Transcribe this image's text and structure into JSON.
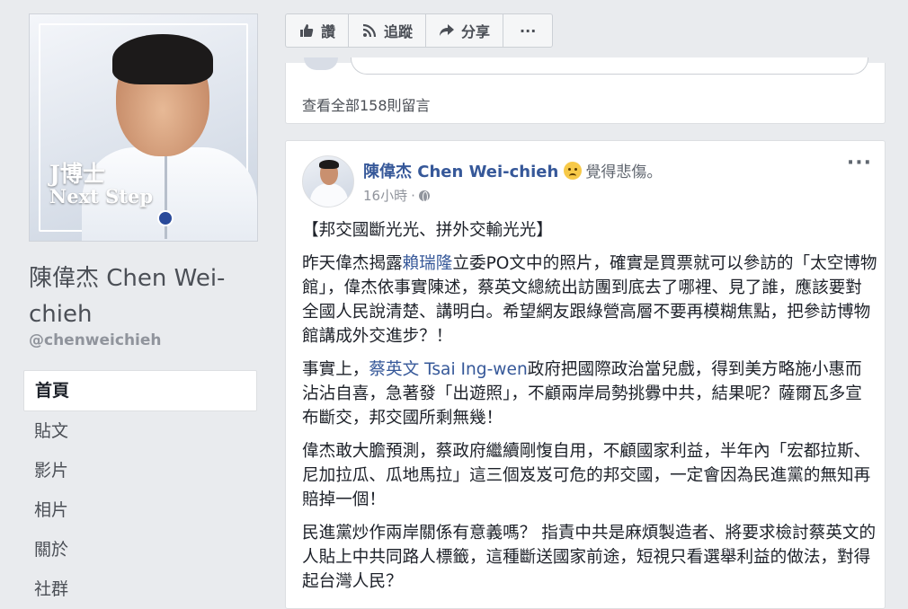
{
  "page": {
    "cover_logo_line1": "J博士",
    "cover_logo_line2": "Next Step",
    "name": "陳偉杰 Chen Wei-chieh",
    "handle": "@chenweichieh"
  },
  "nav": {
    "items": [
      {
        "label": "首頁"
      },
      {
        "label": "貼文"
      },
      {
        "label": "影片"
      },
      {
        "label": "相片"
      },
      {
        "label": "關於"
      },
      {
        "label": "社群"
      }
    ]
  },
  "actions": {
    "like": "讚",
    "follow": "追蹤",
    "share": "分享",
    "more": "···"
  },
  "prev_post": {
    "view_all_comments": "查看全部158則留言"
  },
  "post": {
    "author": "陳偉杰 Chen Wei-chieh",
    "feeling": "覺得悲傷。",
    "time": "16小時",
    "more": "···",
    "title": "【邦交國斷光光、拼外交輸光光】",
    "p1_a": "昨天偉杰揭露",
    "p1_link": "賴瑞隆",
    "p1_b": "立委PO文中的照片，確實是買票就可以參訪的「太空博物館」，偉杰依事實陳述，蔡英文總統出訪團到底去了哪裡、見了誰，應該要對全國人民說清楚、講明白。希望網友跟綠營高層不要再模糊焦點，把參訪博物館講成外交進步？！",
    "p2_a": "事實上，",
    "p2_link": "蔡英文 Tsai Ing-wen",
    "p2_b": "政府把國際政治當兒戲，得到美方略施小惠而沾沾自喜，急著發「出遊照」，不顧兩岸局勢挑釁中共，結果呢？薩爾瓦多宣布斷交，邦交國所剩無幾！",
    "p3": "偉杰敢大膽預測，蔡政府繼續剛愎自用，不顧國家利益，半年內「宏都拉斯、尼加拉瓜、瓜地馬拉」這三個岌岌可危的邦交國，一定會因為民進黨的無知再賠掉一個！",
    "p4": "民進黨炒作兩岸關係有意義嗎？ 指責中共是麻煩製造者、將要求檢討蔡英文的人貼上中共同路人標籤，這種斷送國家前途，短視只看選舉利益的做法，對得起台灣人民？"
  },
  "colors": {
    "link": "#365899",
    "background": "#e9ebee",
    "emoji": "#f7c948"
  }
}
